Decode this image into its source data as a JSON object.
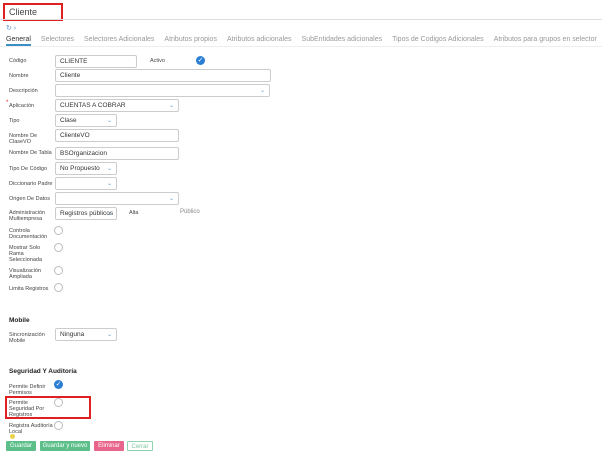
{
  "title": "Cliente",
  "tabs": [
    "General",
    "Selectores",
    "Selectores Adicionales",
    "Atributos propios",
    "Atributos adicionales",
    "SubEntidades adicionales",
    "Tipos de Codigos Adicionales",
    "Atributos para grupos en selector"
  ],
  "fields": {
    "codigo": {
      "label": "Código",
      "value": "CLIENTE"
    },
    "activo": {
      "label": "Activo",
      "checked": true
    },
    "nombre": {
      "label": "Nombre",
      "value": "Cliente"
    },
    "descripcion": {
      "label": "Descripción",
      "value": ""
    },
    "aplicacion": {
      "label": "Aplicación",
      "value": "CUENTAS A COBRAR",
      "required": "*"
    },
    "tipo": {
      "label": "Tipo",
      "value": "Clase"
    },
    "clasevo": {
      "label": "Nombre De ClaseVO",
      "value": "ClienteVO"
    },
    "tabla": {
      "label": "Nombre De Tabla",
      "value": "BSOrganizacion"
    },
    "tipocodigo": {
      "label": "Tipo De Código",
      "value": "No Propuesto"
    },
    "diccionario": {
      "label": "Diccionario Padre",
      "value": ""
    },
    "origen": {
      "label": "Origen De Datos",
      "value": ""
    },
    "multiempresa": {
      "label": "Administración Multiempresa",
      "value": "Registros públicos",
      "alta": "Alta",
      "publico": "Público"
    },
    "controla": {
      "label": "Controla Documentación"
    },
    "rama": {
      "label": "Mostrar Solo Rama Seleccionada"
    },
    "visualizacion": {
      "label": "Visualización Ampliada"
    },
    "limita": {
      "label": "Limita Registros"
    }
  },
  "mobile": {
    "heading": "Mobile",
    "sync_label": "Sincronización Mobile",
    "sync_value": "Ninguna"
  },
  "seguridad": {
    "heading": "Seguridad Y Auditoría",
    "permisos": "Permite Definir Permisos",
    "seguridad_reg": "Permite Seguridad Por Registros",
    "auditoria": "Registra Auditoría Local"
  },
  "buttons": {
    "guardar": "Guardar",
    "guardar_nuevo": "Guardar y nuevo",
    "eliminar": "Eliminar",
    "cerrar": "Cerrar"
  }
}
